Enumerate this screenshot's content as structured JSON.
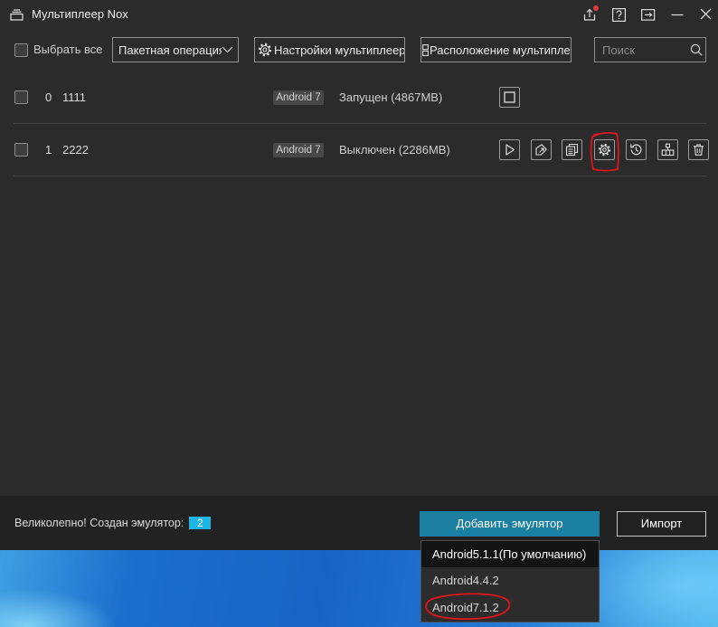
{
  "window": {
    "title": "Мультиплеер Nox",
    "app_icon": "stack-icon"
  },
  "titlebar_icons": [
    "upload-icon",
    "help-icon",
    "exit-icon",
    "minimize-icon",
    "close-icon"
  ],
  "toolbar": {
    "select_all_label": "Выбрать все",
    "batch_operation": "Пакетная операция",
    "settings_label": "Настройки мультиплеер",
    "layout_label": "Расположение мультипле",
    "search_placeholder": "Поиск"
  },
  "emulators": [
    {
      "index": "0",
      "name": "1111",
      "android": "Android 7",
      "status": "Запущен (4867MB)",
      "checked": false,
      "actions": [
        "stop-icon"
      ]
    },
    {
      "index": "1",
      "name": "2222",
      "android": "Android 7",
      "status": "Выключен (2286MB)",
      "checked": false,
      "actions": [
        "play-icon",
        "shortcut-icon",
        "copy-icon",
        "settings-gear-icon",
        "history-icon",
        "network-icon",
        "trash-icon"
      ]
    }
  ],
  "footer": {
    "message": "Великолепно! Создан эмулятор:",
    "created_count": "2",
    "add_button": "Добавить эмулятор",
    "import_button": "Импорт"
  },
  "add_menu": {
    "open": true,
    "items": [
      {
        "label": "Android5.1.1(По умолчанию)",
        "highlighted": true
      },
      {
        "label": "Android4.4.2",
        "highlighted": false
      },
      {
        "label": "Android7.1.2",
        "highlighted": false
      }
    ]
  },
  "colors": {
    "background": "#2b2b2b",
    "accent_button": "#1a7fa0",
    "count_badge": "#1eb4e4",
    "notification_dot": "#e23a3a",
    "annotation": "#e0151b"
  }
}
